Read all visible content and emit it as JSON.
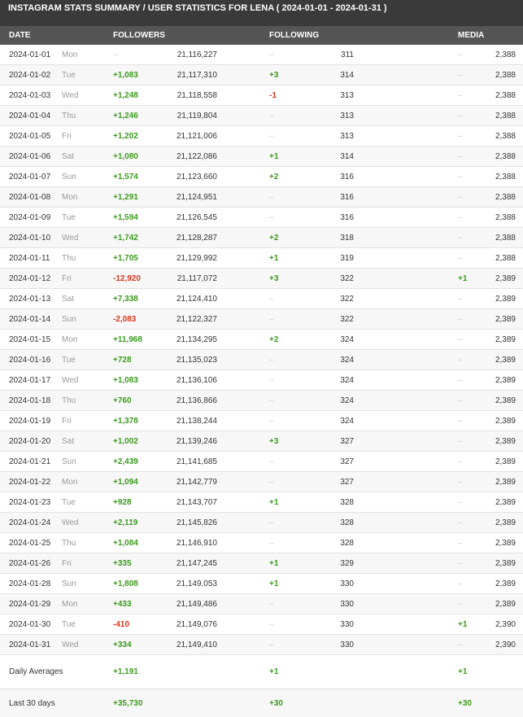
{
  "title": "INSTAGRAM STATS SUMMARY / USER STATISTICS FOR LENA ( 2024-01-01 - 2024-01-31 )",
  "headers": {
    "date": "DATE",
    "followers": "FOLLOWERS",
    "following": "FOLLOWING",
    "media": "MEDIA"
  },
  "rows": [
    [
      "2024-01-01",
      "Mon",
      "–",
      "21,116,227",
      "–",
      "311",
      "–",
      "2,388"
    ],
    [
      "2024-01-02",
      "Tue",
      "+1,083",
      "21,117,310",
      "+3",
      "314",
      "–",
      "2,388"
    ],
    [
      "2024-01-03",
      "Wed",
      "+1,248",
      "21,118,558",
      "-1",
      "313",
      "–",
      "2,388"
    ],
    [
      "2024-01-04",
      "Thu",
      "+1,246",
      "21,119,804",
      "–",
      "313",
      "–",
      "2,388"
    ],
    [
      "2024-01-05",
      "Fri",
      "+1,202",
      "21,121,006",
      "–",
      "313",
      "–",
      "2,388"
    ],
    [
      "2024-01-06",
      "Sat",
      "+1,080",
      "21,122,086",
      "+1",
      "314",
      "–",
      "2,388"
    ],
    [
      "2024-01-07",
      "Sun",
      "+1,574",
      "21,123,660",
      "+2",
      "316",
      "–",
      "2,388"
    ],
    [
      "2024-01-08",
      "Mon",
      "+1,291",
      "21,124,951",
      "–",
      "316",
      "–",
      "2,388"
    ],
    [
      "2024-01-09",
      "Tue",
      "+1,594",
      "21,126,545",
      "–",
      "316",
      "–",
      "2,388"
    ],
    [
      "2024-01-10",
      "Wed",
      "+1,742",
      "21,128,287",
      "+2",
      "318",
      "–",
      "2,388"
    ],
    [
      "2024-01-11",
      "Thu",
      "+1,705",
      "21,129,992",
      "+1",
      "319",
      "–",
      "2,388"
    ],
    [
      "2024-01-12",
      "Fri",
      "-12,920",
      "21,117,072",
      "+3",
      "322",
      "+1",
      "2,389"
    ],
    [
      "2024-01-13",
      "Sat",
      "+7,338",
      "21,124,410",
      "–",
      "322",
      "–",
      "2,389"
    ],
    [
      "2024-01-14",
      "Sun",
      "-2,083",
      "21,122,327",
      "–",
      "322",
      "–",
      "2,389"
    ],
    [
      "2024-01-15",
      "Mon",
      "+11,968",
      "21,134,295",
      "+2",
      "324",
      "–",
      "2,389"
    ],
    [
      "2024-01-16",
      "Tue",
      "+728",
      "21,135,023",
      "–",
      "324",
      "–",
      "2,389"
    ],
    [
      "2024-01-17",
      "Wed",
      "+1,083",
      "21,136,106",
      "–",
      "324",
      "–",
      "2,389"
    ],
    [
      "2024-01-18",
      "Thu",
      "+760",
      "21,136,866",
      "–",
      "324",
      "–",
      "2,389"
    ],
    [
      "2024-01-19",
      "Fri",
      "+1,378",
      "21,138,244",
      "–",
      "324",
      "–",
      "2,389"
    ],
    [
      "2024-01-20",
      "Sat",
      "+1,002",
      "21,139,246",
      "+3",
      "327",
      "–",
      "2,389"
    ],
    [
      "2024-01-21",
      "Sun",
      "+2,439",
      "21,141,685",
      "–",
      "327",
      "–",
      "2,389"
    ],
    [
      "2024-01-22",
      "Mon",
      "+1,094",
      "21,142,779",
      "–",
      "327",
      "–",
      "2,389"
    ],
    [
      "2024-01-23",
      "Tue",
      "+928",
      "21,143,707",
      "+1",
      "328",
      "–",
      "2,389"
    ],
    [
      "2024-01-24",
      "Wed",
      "+2,119",
      "21,145,826",
      "–",
      "328",
      "–",
      "2,389"
    ],
    [
      "2024-01-25",
      "Thu",
      "+1,084",
      "21,146,910",
      "–",
      "328",
      "–",
      "2,389"
    ],
    [
      "2024-01-26",
      "Fri",
      "+335",
      "21,147,245",
      "+1",
      "329",
      "–",
      "2,389"
    ],
    [
      "2024-01-28",
      "Sun",
      "+1,808",
      "21,149,053",
      "+1",
      "330",
      "–",
      "2,389"
    ],
    [
      "2024-01-29",
      "Mon",
      "+433",
      "21,149,486",
      "–",
      "330",
      "–",
      "2,389"
    ],
    [
      "2024-01-30",
      "Tue",
      "-410",
      "21,149,076",
      "–",
      "330",
      "+1",
      "2,390"
    ],
    [
      "2024-01-31",
      "Wed",
      "+334",
      "21,149,410",
      "–",
      "330",
      "–",
      "2,390"
    ]
  ],
  "summary": [
    {
      "label": "Daily Averages",
      "followers": "+1,191",
      "following": "+1",
      "media": "+1"
    },
    {
      "label": "Last 30 days",
      "followers": "+35,730",
      "following": "+30",
      "media": "+30"
    }
  ],
  "colors": {
    "positive": "#3a9b1c",
    "negative": "#d6361b",
    "header_bg": "#555555",
    "title_bg": "#3a3a3a"
  }
}
